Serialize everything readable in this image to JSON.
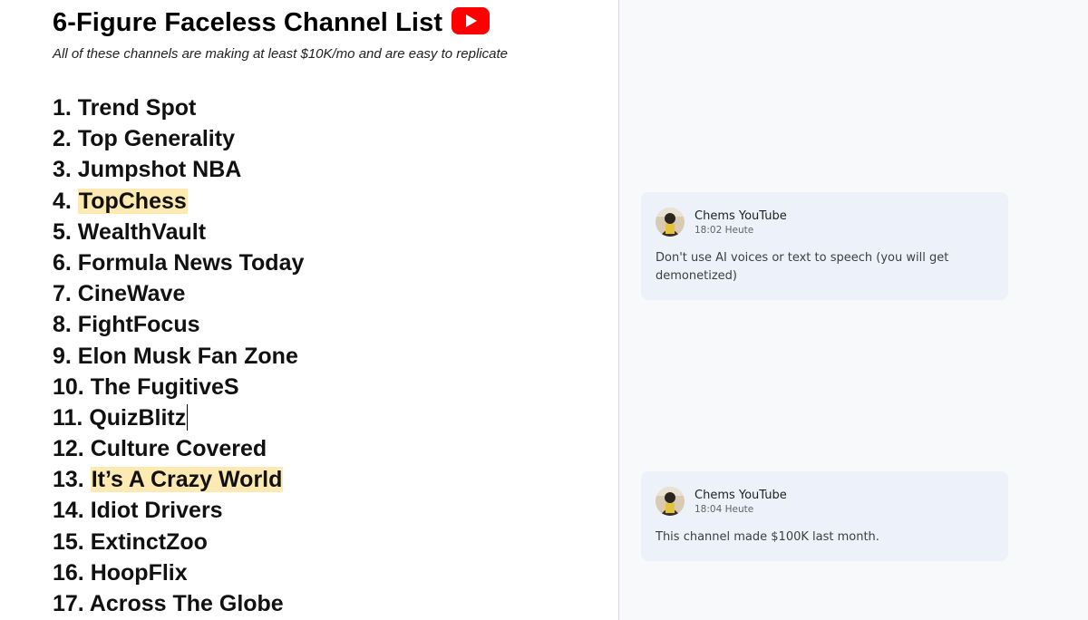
{
  "document": {
    "title": "6-Figure Faceless Channel List",
    "title_icon": "youtube-play-icon",
    "subtitle": "All of these channels are making at least $10K/mo and are easy to replicate",
    "channels": [
      {
        "label": "1. Trend Spot",
        "highlighted": false
      },
      {
        "label": "2. Top Generality",
        "highlighted": false
      },
      {
        "label": "3. Jumpshot NBA",
        "highlighted": false
      },
      {
        "prefix": "4. ",
        "name": "TopChess",
        "highlighted": true
      },
      {
        "label": "5. WealthVault",
        "highlighted": false
      },
      {
        "label": "6. Formula News Today",
        "highlighted": false
      },
      {
        "label": "7. CineWave",
        "highlighted": false
      },
      {
        "label": "8. FightFocus",
        "highlighted": false
      },
      {
        "label": "9. Elon Musk Fan Zone",
        "highlighted": false
      },
      {
        "label": "10. The FugitiveS",
        "highlighted": false
      },
      {
        "label": "11. QuizBlitz",
        "highlighted": false,
        "has_cursor": true
      },
      {
        "label": "12. Culture Covered",
        "highlighted": false
      },
      {
        "prefix": "13. ",
        "name": "It’s A Crazy World",
        "highlighted": true
      },
      {
        "label": "14. Idiot Drivers",
        "highlighted": false
      },
      {
        "label": "15. ExtinctZoo",
        "highlighted": false
      },
      {
        "label": "16. HoopFlix",
        "highlighted": false
      },
      {
        "label": "17. Across The Globe",
        "highlighted": false
      }
    ]
  },
  "comments": [
    {
      "author": "Chems YouTube",
      "time": "18:02 Heute",
      "text": "Don't use AI voices or text to speech (you will get demonetized)"
    },
    {
      "author": "Chems YouTube",
      "time": "18:04 Heute",
      "text": "This channel made $100K last month."
    }
  ],
  "colors": {
    "highlight": "#fde9b2",
    "youtube_red": "#ff0000",
    "comment_bg": "#edf1f9",
    "sidepane_bg": "#f8f9fb"
  }
}
